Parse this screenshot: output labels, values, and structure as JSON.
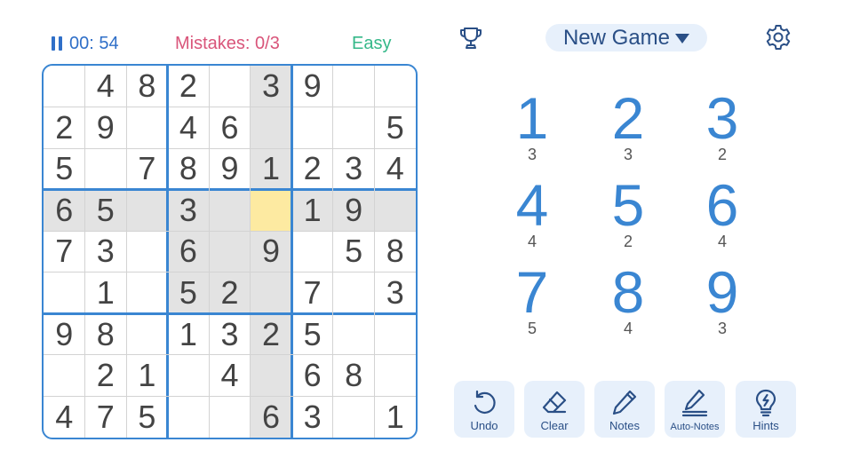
{
  "status": {
    "timer": "00: 54",
    "mistakes": "Mistakes: 0/3",
    "difficulty": "Easy"
  },
  "colors": {
    "accent": "#3a86d2",
    "mistakes": "#d9557a",
    "difficulty": "#35b889",
    "highlight": "#e3e3e3",
    "selected": "#fdeaa1"
  },
  "header": {
    "new_game_label": "New Game",
    "trophy_icon": "trophy-icon",
    "settings_icon": "gear-icon"
  },
  "board": {
    "selected": [
      3,
      5
    ],
    "cells": [
      [
        "",
        "4",
        "8",
        "2",
        "",
        "3",
        "9",
        "",
        ""
      ],
      [
        "2",
        "9",
        "",
        "4",
        "6",
        "",
        "",
        "",
        "5"
      ],
      [
        "5",
        "",
        "7",
        "8",
        "9",
        "1",
        "2",
        "3",
        "4"
      ],
      [
        "6",
        "5",
        "",
        "3",
        "",
        "",
        "1",
        "9",
        ""
      ],
      [
        "7",
        "3",
        "",
        "6",
        "",
        "9",
        "",
        "5",
        "8"
      ],
      [
        "",
        "1",
        "",
        "5",
        "2",
        "",
        "7",
        "",
        "3"
      ],
      [
        "9",
        "8",
        "",
        "1",
        "3",
        "2",
        "5",
        "",
        ""
      ],
      [
        "",
        "2",
        "1",
        "",
        "4",
        "",
        "6",
        "8",
        ""
      ],
      [
        "4",
        "7",
        "5",
        "",
        "",
        "6",
        "3",
        "",
        "1"
      ]
    ]
  },
  "numpad": [
    {
      "digit": "1",
      "remaining": "3"
    },
    {
      "digit": "2",
      "remaining": "3"
    },
    {
      "digit": "3",
      "remaining": "2"
    },
    {
      "digit": "4",
      "remaining": "4"
    },
    {
      "digit": "5",
      "remaining": "2"
    },
    {
      "digit": "6",
      "remaining": "4"
    },
    {
      "digit": "7",
      "remaining": "5"
    },
    {
      "digit": "8",
      "remaining": "4"
    },
    {
      "digit": "9",
      "remaining": "3"
    }
  ],
  "tools": [
    {
      "label": "Undo",
      "icon": "undo-icon"
    },
    {
      "label": "Clear",
      "icon": "eraser-icon"
    },
    {
      "label": "Notes",
      "icon": "pencil-icon"
    },
    {
      "label": "Auto-Notes",
      "icon": "auto-notes-icon"
    },
    {
      "label": "Hints",
      "icon": "lightbulb-icon"
    }
  ]
}
